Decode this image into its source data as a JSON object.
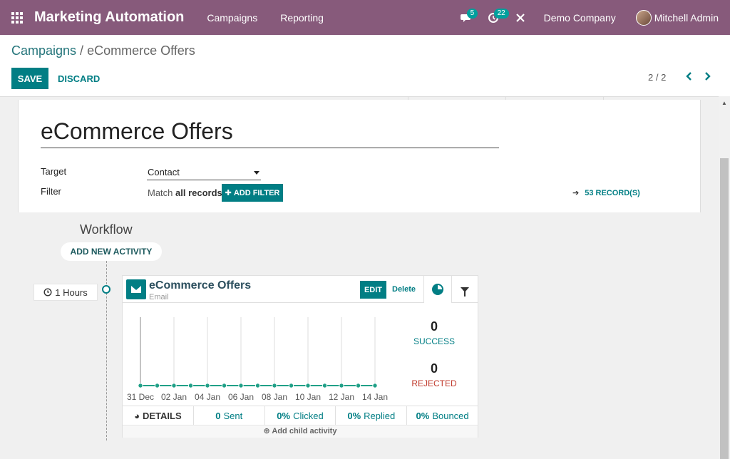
{
  "navbar": {
    "app_title": "Marketing Automation",
    "menus": [
      "Campaigns",
      "Reporting"
    ],
    "messages_count": "5",
    "activities_count": "22",
    "company": "Demo Company",
    "user": "Mitchell Admin"
  },
  "breadcrumb": {
    "parent": "Campaigns",
    "separator": " / ",
    "current": "eCommerce Offers"
  },
  "actions": {
    "save": "SAVE",
    "discard": "DISCARD"
  },
  "pager": {
    "value": "2 / 2"
  },
  "form": {
    "name": "eCommerce Offers",
    "target_label": "Target",
    "target_value": "Contact",
    "filter_label": "Filter",
    "filter_prefix": "Match ",
    "filter_bold": "all records",
    "add_filter": "ADD FILTER",
    "records": "53 RECORD(S)"
  },
  "workflow": {
    "title": "Workflow",
    "add_activity": "ADD NEW ACTIVITY",
    "trigger": "1 Hours",
    "activity": {
      "title": "eCommerce Offers",
      "type": "Email",
      "edit": "EDIT",
      "delete": "Delete",
      "success_value": "0",
      "success_label": "SUCCESS",
      "rejected_value": "0",
      "rejected_label": "REJECTED",
      "footer": {
        "details": "DETAILS",
        "sent_value": "0",
        "sent_label": "Sent",
        "clicked_value": "0%",
        "clicked_label": "Clicked",
        "replied_value": "0%",
        "replied_label": "Replied",
        "bounced_value": "0%",
        "bounced_label": "Bounced"
      },
      "add_child": "Add child activity"
    }
  },
  "colors": {
    "navbar": "#875a7b",
    "primary": "#017e84",
    "success": "#017e84",
    "rejected": "#c0392b",
    "chart_line": "#20a087"
  },
  "chart_data": {
    "type": "line",
    "x": [
      "31 Dec",
      "01 Jan",
      "02 Jan",
      "03 Jan",
      "04 Jan",
      "05 Jan",
      "06 Jan",
      "07 Jan",
      "08 Jan",
      "09 Jan",
      "10 Jan",
      "11 Jan",
      "12 Jan",
      "13 Jan",
      "14 Jan"
    ],
    "tick_labels": [
      "31 Dec",
      "02 Jan",
      "04 Jan",
      "06 Jan",
      "08 Jan",
      "10 Jan",
      "12 Jan",
      "14 Jan"
    ],
    "series": [
      {
        "values": [
          0,
          0,
          0,
          0,
          0,
          0,
          0,
          0,
          0,
          0,
          0,
          0,
          0,
          0,
          0
        ]
      }
    ],
    "grid": "vertical"
  }
}
